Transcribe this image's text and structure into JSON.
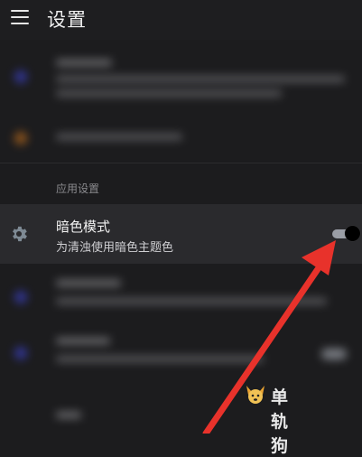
{
  "header": {
    "title": "设置",
    "menu_icon": "hamburger-menu-icon"
  },
  "section": {
    "label": "应用设置"
  },
  "dark_mode": {
    "icon": "gear-icon",
    "title": "暗色模式",
    "subtitle": "为清浊使用暗色主题色",
    "toggle_on": true
  },
  "colors": {
    "background": "#1c1c1e",
    "highlight_row": "#2a2a2d",
    "arrow": "#e8322b",
    "icon_accent": "#3a3fbf"
  },
  "watermark": {
    "text": "单轨狗"
  }
}
